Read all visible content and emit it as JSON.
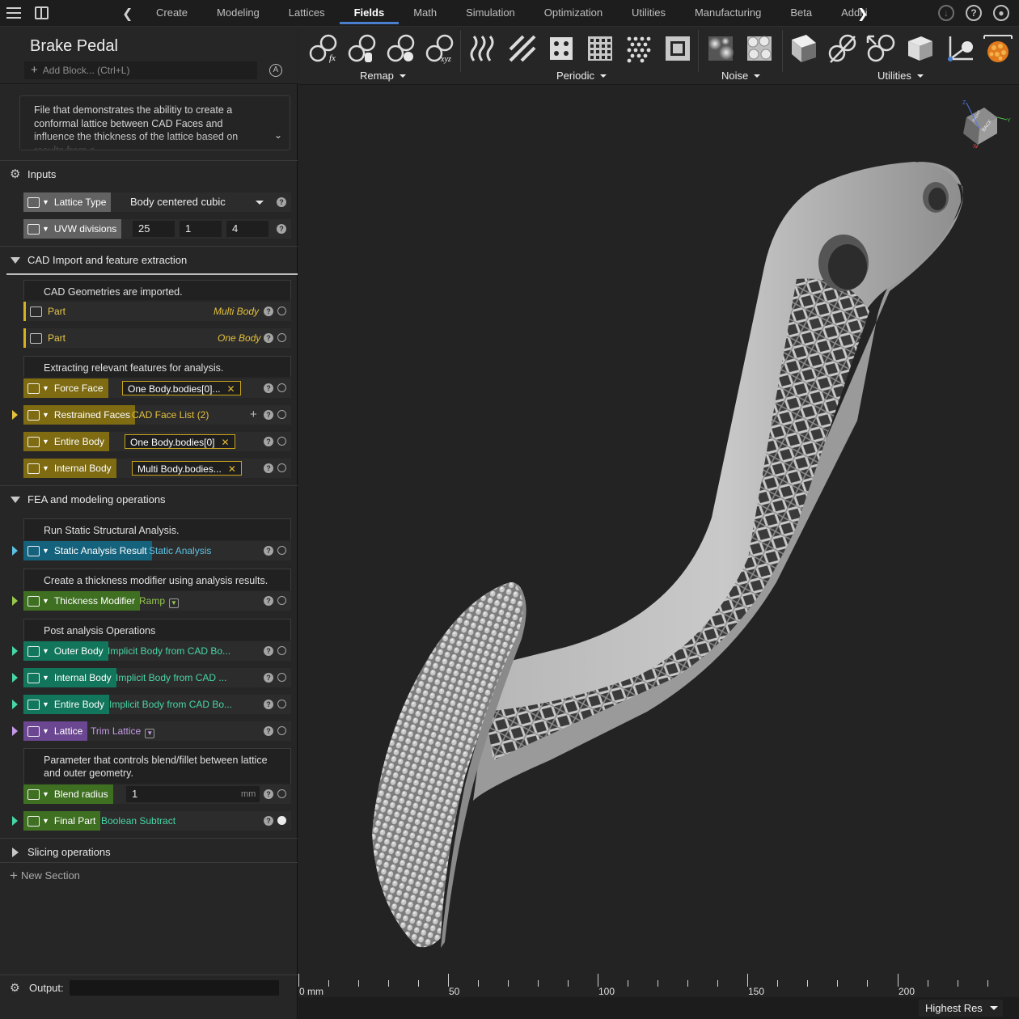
{
  "tabs": [
    "Create",
    "Modeling",
    "Lattices",
    "Fields",
    "Math",
    "Simulation",
    "Optimization",
    "Utilities",
    "Manufacturing",
    "Beta",
    "Additiv"
  ],
  "active_tab": "Fields",
  "title": "Brake Pedal",
  "add_block_placeholder": "Add Block... (Ctrl+L)",
  "description": "File that demonstrates the abilitiy to create a conformal lattice between CAD Faces and influence the thickness of the lattice based on results from a",
  "inputs": {
    "label": "Inputs",
    "lattice_type": {
      "label": "Lattice Type",
      "value": "Body centered cubic"
    },
    "uvw": {
      "label": "UVW divisions",
      "u": "25",
      "v": "1",
      "w": "4"
    }
  },
  "cad_section": {
    "label": "CAD Import and feature extraction",
    "note1": "CAD Geometries are imported.",
    "part1": {
      "label": "Part",
      "value": "Multi Body"
    },
    "part2": {
      "label": "Part",
      "value": "One Body"
    },
    "note2": "Extracting relevant features for analysis.",
    "force_face": {
      "label": "Force Face",
      "value": "One Body.bodies[0]..."
    },
    "restrained": {
      "label": "Restrained Faces",
      "value": "CAD Face List (2)"
    },
    "entire_body": {
      "label": "Entire Body",
      "value": "One Body.bodies[0]"
    },
    "internal_body": {
      "label": "Internal Body",
      "value": "Multi Body.bodies..."
    }
  },
  "fea_section": {
    "label": "FEA and modeling operations",
    "note1": "Run Static Structural Analysis.",
    "static": {
      "label": "Static Analysis Result",
      "value": "Static Analysis"
    },
    "note2": "Create a thickness modifier using analysis results.",
    "thickness": {
      "label": "Thickness Modifier",
      "value": "Ramp"
    },
    "note3": "Post analysis Operations",
    "outer": {
      "label": "Outer Body",
      "value": "Implicit Body from CAD Bo..."
    },
    "internal": {
      "label": "Internal Body",
      "value": "Implicit Body from CAD ..."
    },
    "entire": {
      "label": "Entire Body",
      "value": "Implicit Body from CAD Bo..."
    },
    "lattice": {
      "label": "Lattice",
      "value": "Trim Lattice"
    },
    "note4": "Parameter that controls blend/fillet between lattice and outer geometry.",
    "blend": {
      "label": "Blend radius",
      "value": "1",
      "unit": "mm"
    },
    "final": {
      "label": "Final Part",
      "value": "Boolean Subtract"
    }
  },
  "slicing_section": {
    "label": "Slicing operations"
  },
  "new_section": "New Section",
  "output_label": "Output:",
  "toolbar_groups": [
    "Remap",
    "Periodic",
    "Noise",
    "Utilities"
  ],
  "viewcube_labels": {
    "front": "BACK",
    "top": "RIGHT",
    "axes": [
      "Z",
      "Y",
      "X"
    ]
  },
  "ruler": {
    "labels": [
      "0 mm",
      "50",
      "100",
      "150",
      "200"
    ]
  },
  "resolution": "Highest Res",
  "colors": {
    "accent": "#4a7fd0",
    "olive": "#7e6b12",
    "teal": "#15627d",
    "green": "#3f7022",
    "emerald": "#12765c",
    "purple": "#6b4691",
    "part_yellow": "#d6b21a"
  }
}
